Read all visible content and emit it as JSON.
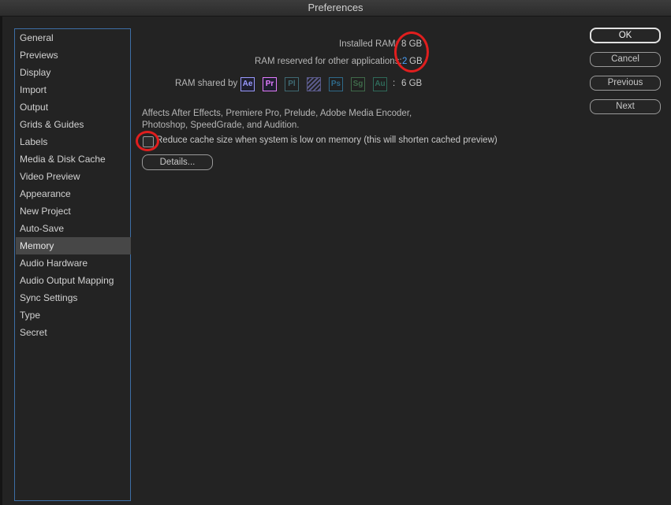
{
  "window": {
    "title": "Preferences"
  },
  "sidebar": {
    "items": [
      {
        "label": "General"
      },
      {
        "label": "Previews"
      },
      {
        "label": "Display"
      },
      {
        "label": "Import"
      },
      {
        "label": "Output"
      },
      {
        "label": "Grids & Guides"
      },
      {
        "label": "Labels"
      },
      {
        "label": "Media & Disk Cache"
      },
      {
        "label": "Video Preview"
      },
      {
        "label": "Appearance"
      },
      {
        "label": "New Project"
      },
      {
        "label": "Auto-Save"
      },
      {
        "label": "Memory",
        "selected": true
      },
      {
        "label": "Audio Hardware"
      },
      {
        "label": "Audio Output Mapping"
      },
      {
        "label": "Sync Settings"
      },
      {
        "label": "Type"
      },
      {
        "label": "Secret"
      }
    ]
  },
  "memory": {
    "installed_label": "Installed RAM:",
    "installed_value": "8 GB",
    "reserved_label": "RAM reserved for other applications:",
    "reserved_value": "2",
    "reserved_unit": "GB",
    "shared_label": "RAM shared by",
    "shared_separator": ":",
    "shared_value": "6 GB",
    "apps": [
      {
        "abbr": "Ae",
        "color": "#9999ff",
        "active": true
      },
      {
        "abbr": "Pr",
        "color": "#e27bff",
        "active": true
      },
      {
        "abbr": "Pl",
        "color": "#3f6a74",
        "active": false
      },
      {
        "abbr": "",
        "color": "#5a5a8a",
        "active": false
      },
      {
        "abbr": "Ps",
        "color": "#2f6a8a",
        "active": false
      },
      {
        "abbr": "Sg",
        "color": "#3f6a4a",
        "active": false
      },
      {
        "abbr": "Au",
        "color": "#2f6a5a",
        "active": false
      }
    ],
    "description": "Affects After Effects, Premiere Pro, Prelude, Adobe Media Encoder, Photoshop, SpeedGrade, and Audition.",
    "reduce_cache_label": "Reduce cache size when system is low on memory (this will shorten cached preview)",
    "reduce_cache_checked": false,
    "details_label": "Details..."
  },
  "buttons": {
    "ok": "OK",
    "cancel": "Cancel",
    "previous": "Previous",
    "next": "Next"
  },
  "annotation_color": "#e01e1e"
}
